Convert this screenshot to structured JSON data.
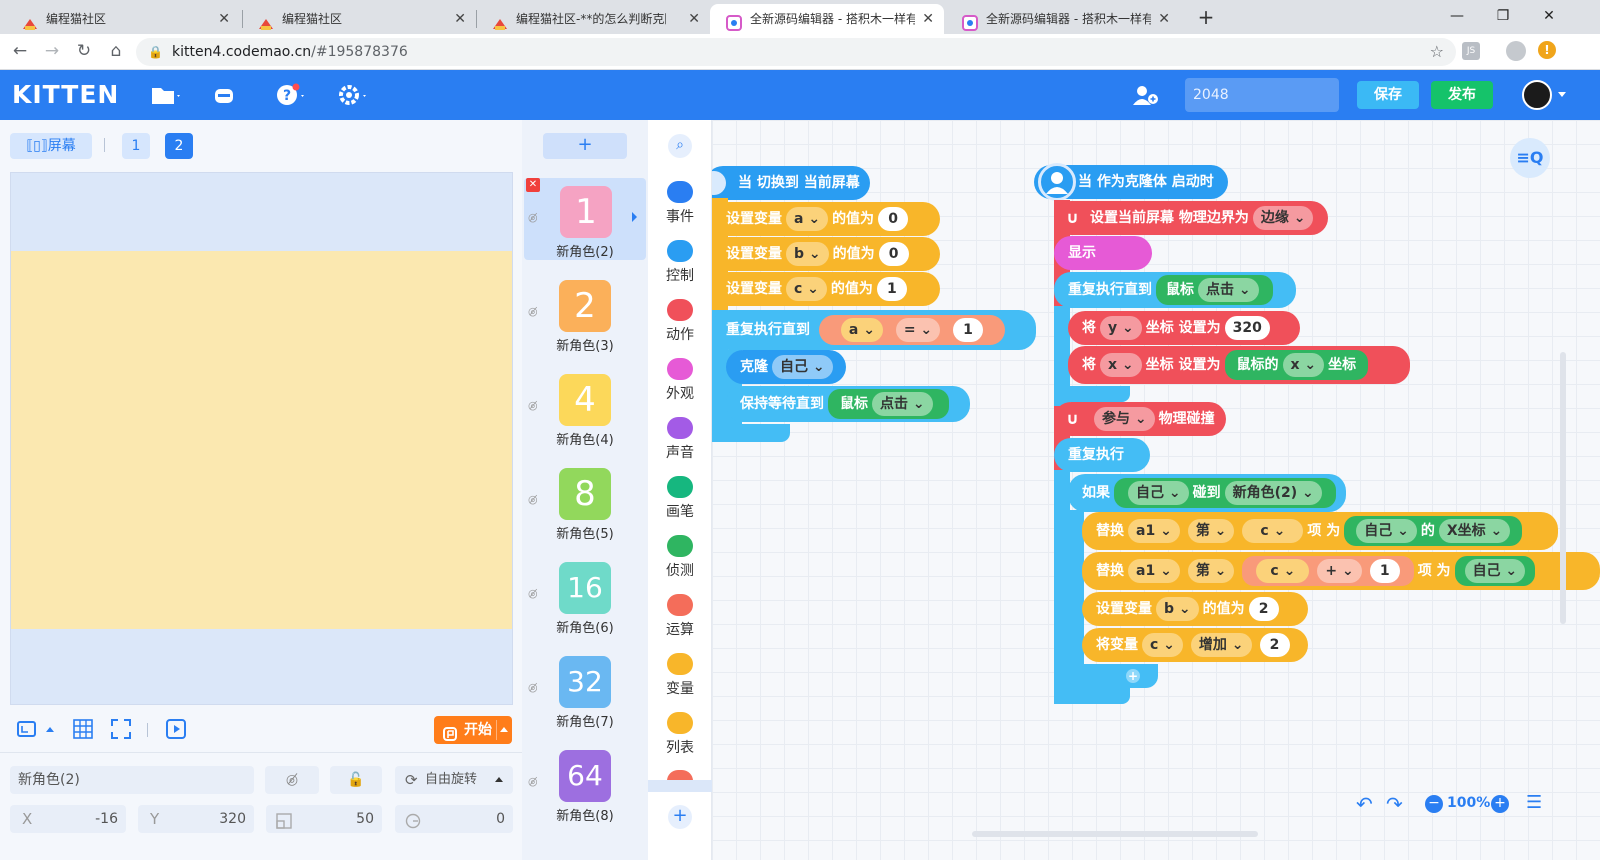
{
  "browser": {
    "tabs": [
      {
        "title": "编程猫社区"
      },
      {
        "title": "编程猫社区"
      },
      {
        "title": "编程猫社区-**的怎么判断克隆体"
      },
      {
        "title": "全新源码编辑器 - 搭积木一样有趣"
      },
      {
        "title": "全新源码编辑器 - 搭积木一样有趣"
      }
    ],
    "url_host": "kitten4.codemao.cn",
    "url_path": "/#195878376",
    "new_tab": "+",
    "close": "✕"
  },
  "header": {
    "logo": "KITTEN",
    "project_name": "2048",
    "save": "保存",
    "publish": "发布"
  },
  "stage": {
    "screen_button": "屏幕",
    "pages": [
      "1",
      "2"
    ],
    "start_button": "开始"
  },
  "properties": {
    "name": "新角色(2)",
    "rotation": "自由旋转",
    "x_label": "X",
    "x_value": "-16",
    "y_label": "Y",
    "y_value": "320",
    "size_value": "50",
    "rotation_value": "0"
  },
  "sprites": {
    "add": "+",
    "items": [
      {
        "glyph": "1",
        "name": "新角色(2)",
        "color": "#f5a3c3"
      },
      {
        "glyph": "2",
        "name": "新角色(3)",
        "color": "#fbb05a"
      },
      {
        "glyph": "4",
        "name": "新角色(4)",
        "color": "#fcd85a"
      },
      {
        "glyph": "8",
        "name": "新角色(5)",
        "color": "#92d85c"
      },
      {
        "glyph": "16",
        "name": "新角色(6)",
        "color": "#6fdac9"
      },
      {
        "glyph": "32",
        "name": "新角色(7)",
        "color": "#6ab8f2"
      },
      {
        "glyph": "64",
        "name": "新角色(8)",
        "color": "#9d6fe0"
      }
    ]
  },
  "categories": [
    {
      "label": "事件",
      "color": "#2a7ef2"
    },
    {
      "label": "控制",
      "color": "#2a9df2"
    },
    {
      "label": "动作",
      "color": "#f0505a"
    },
    {
      "label": "外观",
      "color": "#e65ad6"
    },
    {
      "label": "声音",
      "color": "#a35be6"
    },
    {
      "label": "画笔",
      "color": "#16b77f"
    },
    {
      "label": "侦测",
      "color": "#2fb561"
    },
    {
      "label": "运算",
      "color": "#f46d5a"
    },
    {
      "label": "变量",
      "color": "#f8b62a"
    },
    {
      "label": "列表",
      "color": "#f8b62a"
    }
  ],
  "script1": {
    "hat": "当 切换到 当前屏幕",
    "set_var": "设置变量",
    "value_of": "的值为",
    "var_a": "a",
    "val_a": "0",
    "var_b": "b",
    "val_b": "0",
    "var_c": "c",
    "val_c": "1",
    "repeat_until": "重复执行直到",
    "cond_var": "a",
    "cond_op": "=",
    "cond_val": "1",
    "clone": "克隆",
    "self": "自己",
    "wait_until": "保持等待直到",
    "mouse": "鼠标",
    "click": "点击"
  },
  "script2": {
    "hat": "当 作为克隆体 启动时",
    "physics_border": "设置当前屏幕 物理边界为",
    "edge": "边缘",
    "show": "显示",
    "repeat_until": "重复执行直到",
    "mouse": "鼠标",
    "click": "点击",
    "set": "将",
    "y": "y",
    "coord_set": "坐标 设置为",
    "y_val": "320",
    "x": "x",
    "mouse_of": "鼠标的",
    "coord": "坐标",
    "participate": "参与",
    "physics_collision": "物理碰撞",
    "forever": "重复执行",
    "if": "如果",
    "self": "自己",
    "touch": "碰到",
    "sprite": "新角色(2)",
    "replace": "替换",
    "list": "a1",
    "nth": "第",
    "c": "c",
    "item_as": "项 为",
    "of": "的",
    "xcoord": "X坐标",
    "plus": "+",
    "one": "1",
    "set_var": "设置变量",
    "var_b": "b",
    "value_of": "的值为",
    "two": "2",
    "change_var": "将变量",
    "increase": "增加",
    "add_slot": "+"
  },
  "zoom": {
    "level": "100%"
  }
}
